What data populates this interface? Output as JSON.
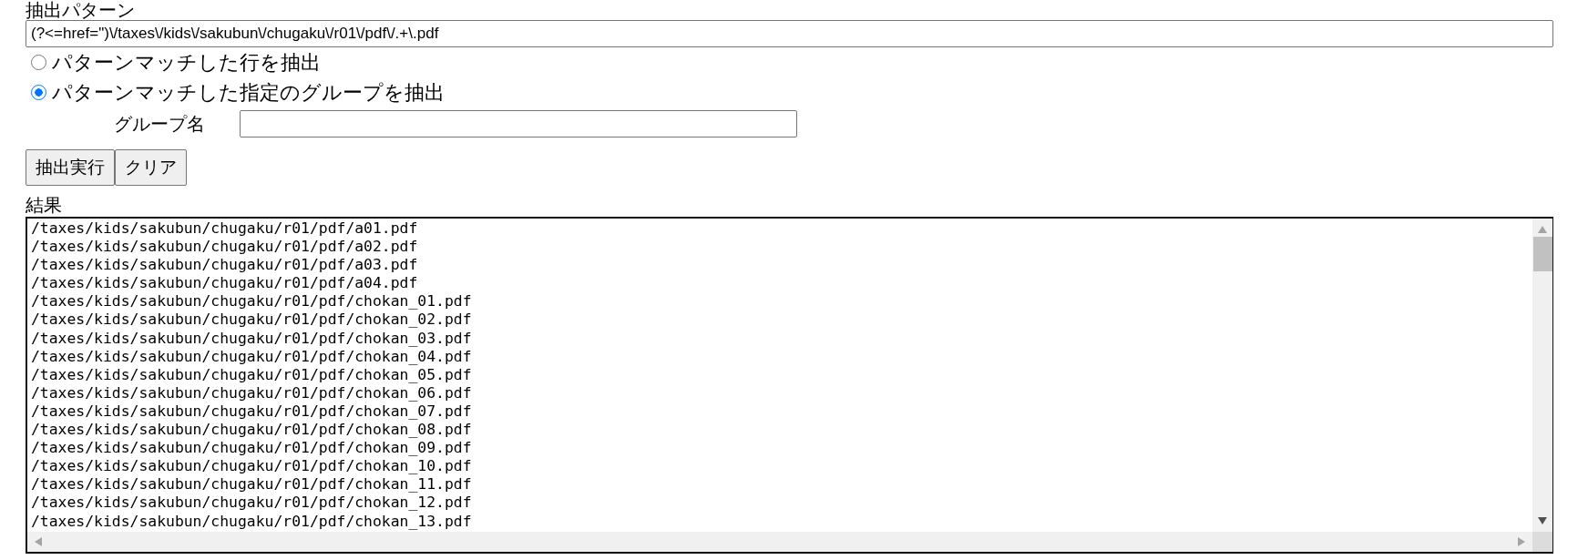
{
  "pattern": {
    "label": "抽出パターン",
    "value": "(?<=href=\")\\/taxes\\/kids\\/sakubun\\/chugaku\\/r01\\/pdf\\/.+\\.pdf"
  },
  "modes": [
    {
      "label": "パターンマッチした行を抽出",
      "selected": false
    },
    {
      "label": "パターンマッチした指定のグループを抽出",
      "selected": true
    }
  ],
  "group_name": {
    "label": "グループ名"
  },
  "buttons": [
    "抽出実行",
    "クリア"
  ],
  "result": {
    "label": "結果",
    "lines": [
      "/taxes/kids/sakubun/chugaku/r01/pdf/a01.pdf",
      "/taxes/kids/sakubun/chugaku/r01/pdf/a02.pdf",
      "/taxes/kids/sakubun/chugaku/r01/pdf/a03.pdf",
      "/taxes/kids/sakubun/chugaku/r01/pdf/a04.pdf",
      "/taxes/kids/sakubun/chugaku/r01/pdf/chokan_01.pdf",
      "/taxes/kids/sakubun/chugaku/r01/pdf/chokan_02.pdf",
      "/taxes/kids/sakubun/chugaku/r01/pdf/chokan_03.pdf",
      "/taxes/kids/sakubun/chugaku/r01/pdf/chokan_04.pdf",
      "/taxes/kids/sakubun/chugaku/r01/pdf/chokan_05.pdf",
      "/taxes/kids/sakubun/chugaku/r01/pdf/chokan_06.pdf",
      "/taxes/kids/sakubun/chugaku/r01/pdf/chokan_07.pdf",
      "/taxes/kids/sakubun/chugaku/r01/pdf/chokan_08.pdf",
      "/taxes/kids/sakubun/chugaku/r01/pdf/chokan_09.pdf",
      "/taxes/kids/sakubun/chugaku/r01/pdf/chokan_10.pdf",
      "/taxes/kids/sakubun/chugaku/r01/pdf/chokan_11.pdf",
      "/taxes/kids/sakubun/chugaku/r01/pdf/chokan_12.pdf",
      "/taxes/kids/sakubun/chugaku/r01/pdf/chokan_13.pdf"
    ]
  }
}
